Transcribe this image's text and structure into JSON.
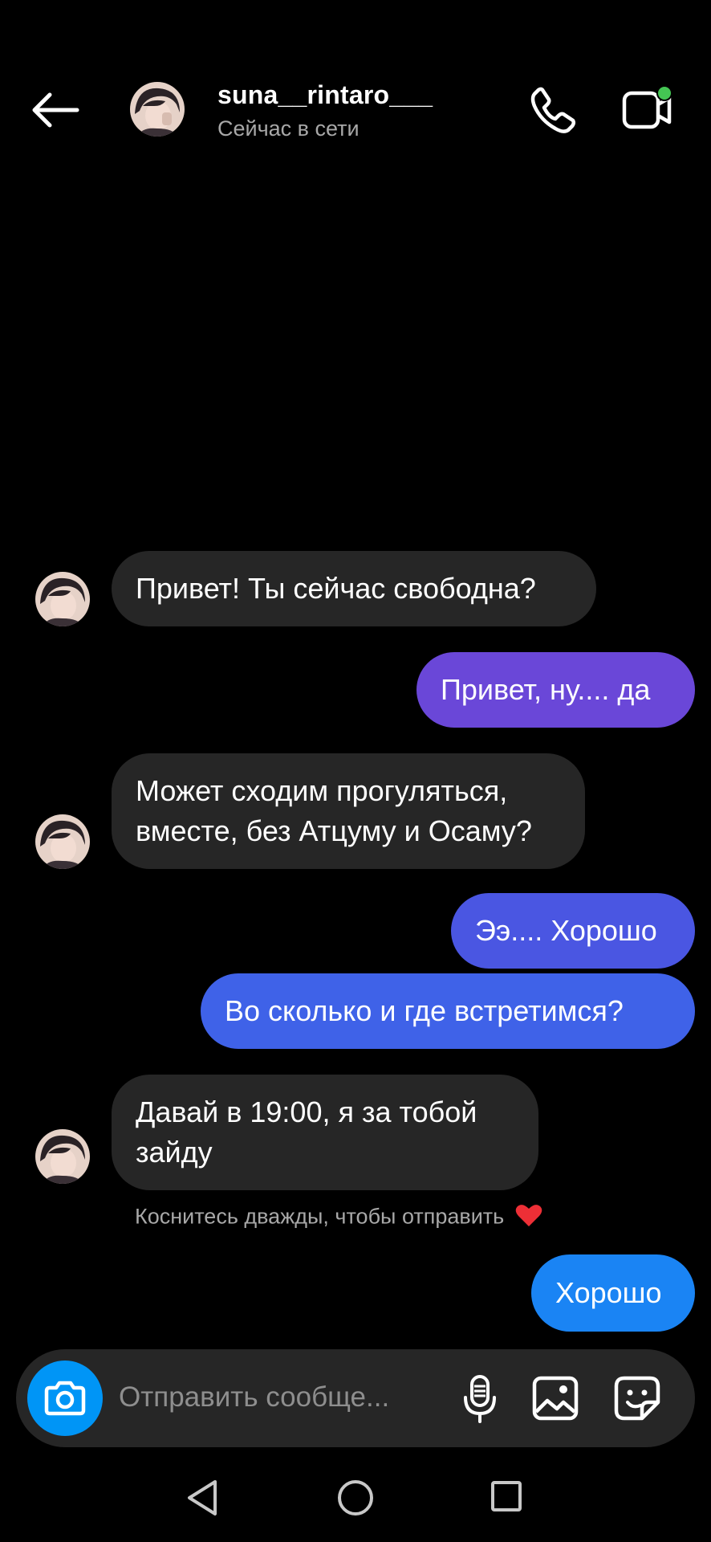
{
  "header": {
    "username": "suna__rintaro___",
    "status": "Сейчас в сети",
    "online_indicator_color": "#44c553"
  },
  "messages": [
    {
      "side": "in",
      "text": "Привет! Ты сейчас свободна?"
    },
    {
      "side": "out",
      "text": "Привет, ну.... да",
      "color": "#6a47d8"
    },
    {
      "side": "in",
      "lines": [
        "Может сходим прогуляться,",
        "вместе, без Атцуму и Осаму?"
      ]
    },
    {
      "side": "out",
      "text": "Ээ.... Хорошо",
      "color": "#4a56e2"
    },
    {
      "side": "out",
      "text": "Во сколько и где встретимся?",
      "color": "#3f62e8"
    },
    {
      "side": "in",
      "lines": [
        "Давай в 19:00, я за тобой",
        "зайду"
      ]
    },
    {
      "side": "out",
      "text": "Хорошо",
      "color": "#1a84f4"
    }
  ],
  "hint": "Коснитесь дважды, чтобы отправить",
  "composer": {
    "placeholder": "Отправить сообще..."
  },
  "colors": {
    "incoming_bubble": "#262626",
    "camera_button": "#0095f6",
    "heart": "#ed2f36"
  }
}
